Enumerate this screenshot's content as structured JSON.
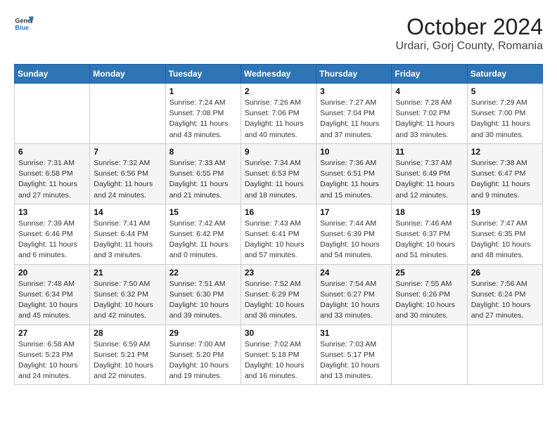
{
  "header": {
    "logo_line1": "General",
    "logo_line2": "Blue",
    "title": "October 2024",
    "subtitle": "Urdari, Gorj County, Romania"
  },
  "weekdays": [
    "Sunday",
    "Monday",
    "Tuesday",
    "Wednesday",
    "Thursday",
    "Friday",
    "Saturday"
  ],
  "weeks": [
    [
      {
        "day": "",
        "info": ""
      },
      {
        "day": "",
        "info": ""
      },
      {
        "day": "1",
        "info": "Sunrise: 7:24 AM\nSunset: 7:08 PM\nDaylight: 11 hours and 43 minutes."
      },
      {
        "day": "2",
        "info": "Sunrise: 7:26 AM\nSunset: 7:06 PM\nDaylight: 11 hours and 40 minutes."
      },
      {
        "day": "3",
        "info": "Sunrise: 7:27 AM\nSunset: 7:04 PM\nDaylight: 11 hours and 37 minutes."
      },
      {
        "day": "4",
        "info": "Sunrise: 7:28 AM\nSunset: 7:02 PM\nDaylight: 11 hours and 33 minutes."
      },
      {
        "day": "5",
        "info": "Sunrise: 7:29 AM\nSunset: 7:00 PM\nDaylight: 11 hours and 30 minutes."
      }
    ],
    [
      {
        "day": "6",
        "info": "Sunrise: 7:31 AM\nSunset: 6:58 PM\nDaylight: 11 hours and 27 minutes."
      },
      {
        "day": "7",
        "info": "Sunrise: 7:32 AM\nSunset: 6:56 PM\nDaylight: 11 hours and 24 minutes."
      },
      {
        "day": "8",
        "info": "Sunrise: 7:33 AM\nSunset: 6:55 PM\nDaylight: 11 hours and 21 minutes."
      },
      {
        "day": "9",
        "info": "Sunrise: 7:34 AM\nSunset: 6:53 PM\nDaylight: 11 hours and 18 minutes."
      },
      {
        "day": "10",
        "info": "Sunrise: 7:36 AM\nSunset: 6:51 PM\nDaylight: 11 hours and 15 minutes."
      },
      {
        "day": "11",
        "info": "Sunrise: 7:37 AM\nSunset: 6:49 PM\nDaylight: 11 hours and 12 minutes."
      },
      {
        "day": "12",
        "info": "Sunrise: 7:38 AM\nSunset: 6:47 PM\nDaylight: 11 hours and 9 minutes."
      }
    ],
    [
      {
        "day": "13",
        "info": "Sunrise: 7:39 AM\nSunset: 6:46 PM\nDaylight: 11 hours and 6 minutes."
      },
      {
        "day": "14",
        "info": "Sunrise: 7:41 AM\nSunset: 6:44 PM\nDaylight: 11 hours and 3 minutes."
      },
      {
        "day": "15",
        "info": "Sunrise: 7:42 AM\nSunset: 6:42 PM\nDaylight: 11 hours and 0 minutes."
      },
      {
        "day": "16",
        "info": "Sunrise: 7:43 AM\nSunset: 6:41 PM\nDaylight: 10 hours and 57 minutes."
      },
      {
        "day": "17",
        "info": "Sunrise: 7:44 AM\nSunset: 6:39 PM\nDaylight: 10 hours and 54 minutes."
      },
      {
        "day": "18",
        "info": "Sunrise: 7:46 AM\nSunset: 6:37 PM\nDaylight: 10 hours and 51 minutes."
      },
      {
        "day": "19",
        "info": "Sunrise: 7:47 AM\nSunset: 6:35 PM\nDaylight: 10 hours and 48 minutes."
      }
    ],
    [
      {
        "day": "20",
        "info": "Sunrise: 7:48 AM\nSunset: 6:34 PM\nDaylight: 10 hours and 45 minutes."
      },
      {
        "day": "21",
        "info": "Sunrise: 7:50 AM\nSunset: 6:32 PM\nDaylight: 10 hours and 42 minutes."
      },
      {
        "day": "22",
        "info": "Sunrise: 7:51 AM\nSunset: 6:30 PM\nDaylight: 10 hours and 39 minutes."
      },
      {
        "day": "23",
        "info": "Sunrise: 7:52 AM\nSunset: 6:29 PM\nDaylight: 10 hours and 36 minutes."
      },
      {
        "day": "24",
        "info": "Sunrise: 7:54 AM\nSunset: 6:27 PM\nDaylight: 10 hours and 33 minutes."
      },
      {
        "day": "25",
        "info": "Sunrise: 7:55 AM\nSunset: 6:26 PM\nDaylight: 10 hours and 30 minutes."
      },
      {
        "day": "26",
        "info": "Sunrise: 7:56 AM\nSunset: 6:24 PM\nDaylight: 10 hours and 27 minutes."
      }
    ],
    [
      {
        "day": "27",
        "info": "Sunrise: 6:58 AM\nSunset: 5:23 PM\nDaylight: 10 hours and 24 minutes."
      },
      {
        "day": "28",
        "info": "Sunrise: 6:59 AM\nSunset: 5:21 PM\nDaylight: 10 hours and 22 minutes."
      },
      {
        "day": "29",
        "info": "Sunrise: 7:00 AM\nSunset: 5:20 PM\nDaylight: 10 hours and 19 minutes."
      },
      {
        "day": "30",
        "info": "Sunrise: 7:02 AM\nSunset: 5:18 PM\nDaylight: 10 hours and 16 minutes."
      },
      {
        "day": "31",
        "info": "Sunrise: 7:03 AM\nSunset: 5:17 PM\nDaylight: 10 hours and 13 minutes."
      },
      {
        "day": "",
        "info": ""
      },
      {
        "day": "",
        "info": ""
      }
    ]
  ]
}
